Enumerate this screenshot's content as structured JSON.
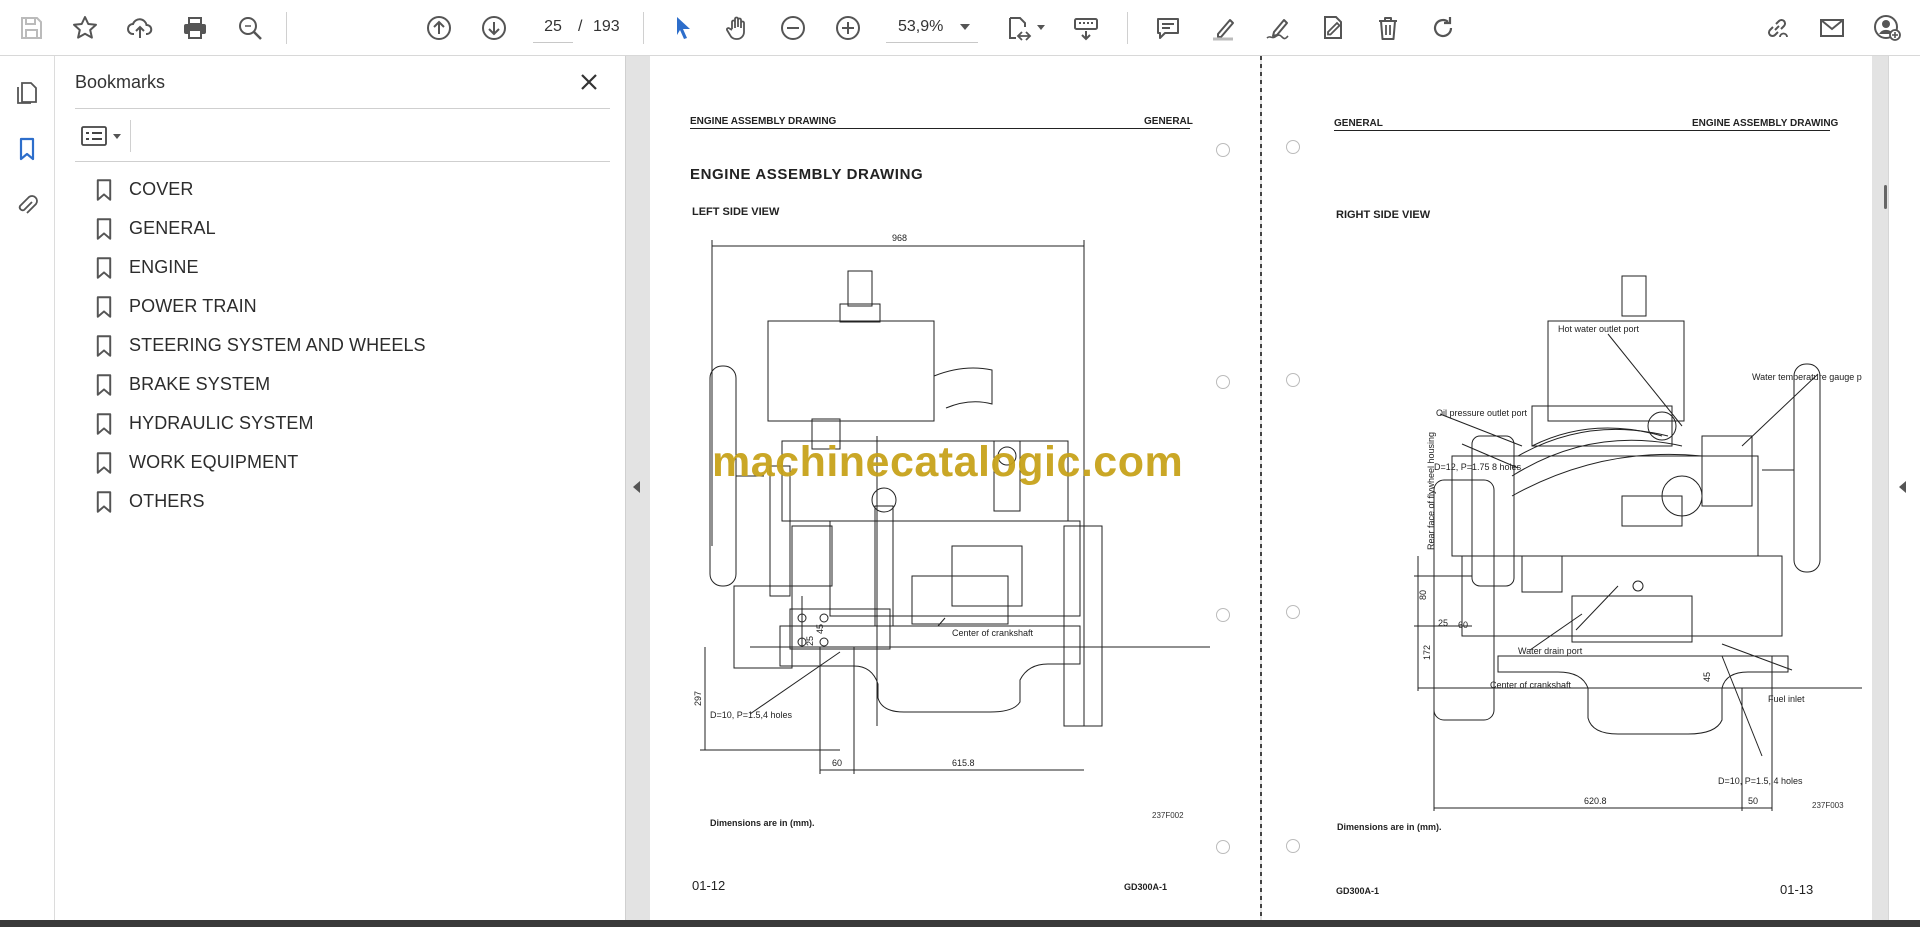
{
  "toolbar": {
    "page_current": "25",
    "page_separator": "/",
    "page_total": "193",
    "zoom": "53,9%",
    "icons": [
      "save-icon",
      "star-icon",
      "upload-icon",
      "print-icon",
      "zoom-search-icon",
      "arrow-up-icon",
      "arrow-down-icon",
      "select-cursor-icon",
      "hand-icon",
      "zoom-out-icon",
      "zoom-in-icon",
      "fit-page-icon",
      "scroll-mode-icon",
      "comment-icon",
      "highlight-icon",
      "draw-icon",
      "fill-sign-icon",
      "delete-icon",
      "redo-icon",
      "share-link-icon",
      "mail-icon",
      "account-icon"
    ]
  },
  "panel": {
    "title": "Bookmarks",
    "items": [
      {
        "label": "COVER"
      },
      {
        "label": "GENERAL"
      },
      {
        "label": "ENGINE"
      },
      {
        "label": "POWER TRAIN"
      },
      {
        "label": "STEERING SYSTEM AND WHEELS"
      },
      {
        "label": "BRAKE SYSTEM"
      },
      {
        "label": "HYDRAULIC SYSTEM"
      },
      {
        "label": "WORK EQUIPMENT"
      },
      {
        "label": "OTHERS"
      }
    ]
  },
  "left_page": {
    "header_left": "ENGINE ASSEMBLY DRAWING",
    "header_right": "GENERAL",
    "title": "ENGINE  ASSEMBLY  DRAWING",
    "view": "LEFT SIDE VIEW",
    "dim_top": "968",
    "dim_60": "60",
    "dim_615": "615.8",
    "dim_297": "297",
    "dim_45": "45",
    "dim_25": "25",
    "label_crank": "Center of crankshaft",
    "label_holes": "D=10, P=1.5,4 holes",
    "code": "237F002",
    "note": "Dimensions are in (mm).",
    "page_no": "01-12",
    "model": "GD300A-1"
  },
  "right_page": {
    "header_left": "GENERAL",
    "header_right": "ENGINE ASSEMBLY DRAWING",
    "view": "RIGHT SIDE VIEW",
    "label_hot_water": "Hot water outlet port",
    "label_water_temp": "Water temperature gauge port",
    "label_oil": "Oil pressure outlet port",
    "label_d12": "D=12, P=1.75 8 holes",
    "label_rear": "Rear face of flywheel housing",
    "label_drain": "Water drain port",
    "label_crank": "Center of crankshaft",
    "label_fuel": "Fuel inlet",
    "label_holes": "D=10, P=1.5, 4 holes",
    "dim_80": "80",
    "dim_25": "25",
    "dim_60": "60",
    "dim_172": "172",
    "dim_45": "45",
    "dim_620": "620.8",
    "dim_50": "50",
    "code": "237F003",
    "note": "Dimensions are in (mm).",
    "page_no": "01-13",
    "model": "GD300A-1"
  },
  "watermark": "machinecatalogic.com",
  "colors": {
    "accent": "#2d6ecb",
    "watermark": "#c8a31b",
    "gutter": "#e3e3e3"
  }
}
